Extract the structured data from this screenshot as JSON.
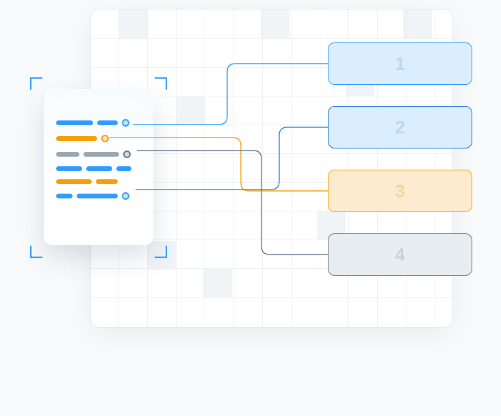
{
  "diagram": {
    "targets": [
      {
        "label": "1",
        "color": "blue"
      },
      {
        "label": "2",
        "color": "darkblue"
      },
      {
        "label": "3",
        "color": "orange"
      },
      {
        "label": "4",
        "color": "gray"
      }
    ],
    "document": {
      "lines": [
        {
          "segments": [
            "blue-long",
            "blue-med"
          ],
          "node": "blue"
        },
        {
          "segments": [
            "orange-long",
            "orange-short"
          ],
          "node": "orange"
        },
        {
          "segments": [
            "gray-med",
            "gray-long"
          ],
          "node": "gray"
        },
        {
          "segments": [
            "blue-med",
            "blue-med",
            "blue-short"
          ],
          "node": null
        },
        {
          "segments": [
            "orange-long",
            "orange-med"
          ],
          "node": null
        },
        {
          "segments": [
            "blue-short",
            "blue-long"
          ],
          "node": "blue"
        }
      ]
    },
    "links": [
      {
        "from_line": 1,
        "to_target": 1,
        "color": "#2f9bff"
      },
      {
        "from_line": 2,
        "to_target": 3,
        "color": "#f59e0b"
      },
      {
        "from_line": 3,
        "to_target": 4,
        "color": "#64748b"
      },
      {
        "from_line": 6,
        "to_target": 2,
        "color": "#1170d1"
      }
    ],
    "colors": {
      "blue": "#2f9bff",
      "darkblue": "#1170d1",
      "orange": "#f59e0b",
      "gray": "#64748b",
      "panel_bg": "#ffffff",
      "page_bg": "#f9fafb"
    }
  }
}
